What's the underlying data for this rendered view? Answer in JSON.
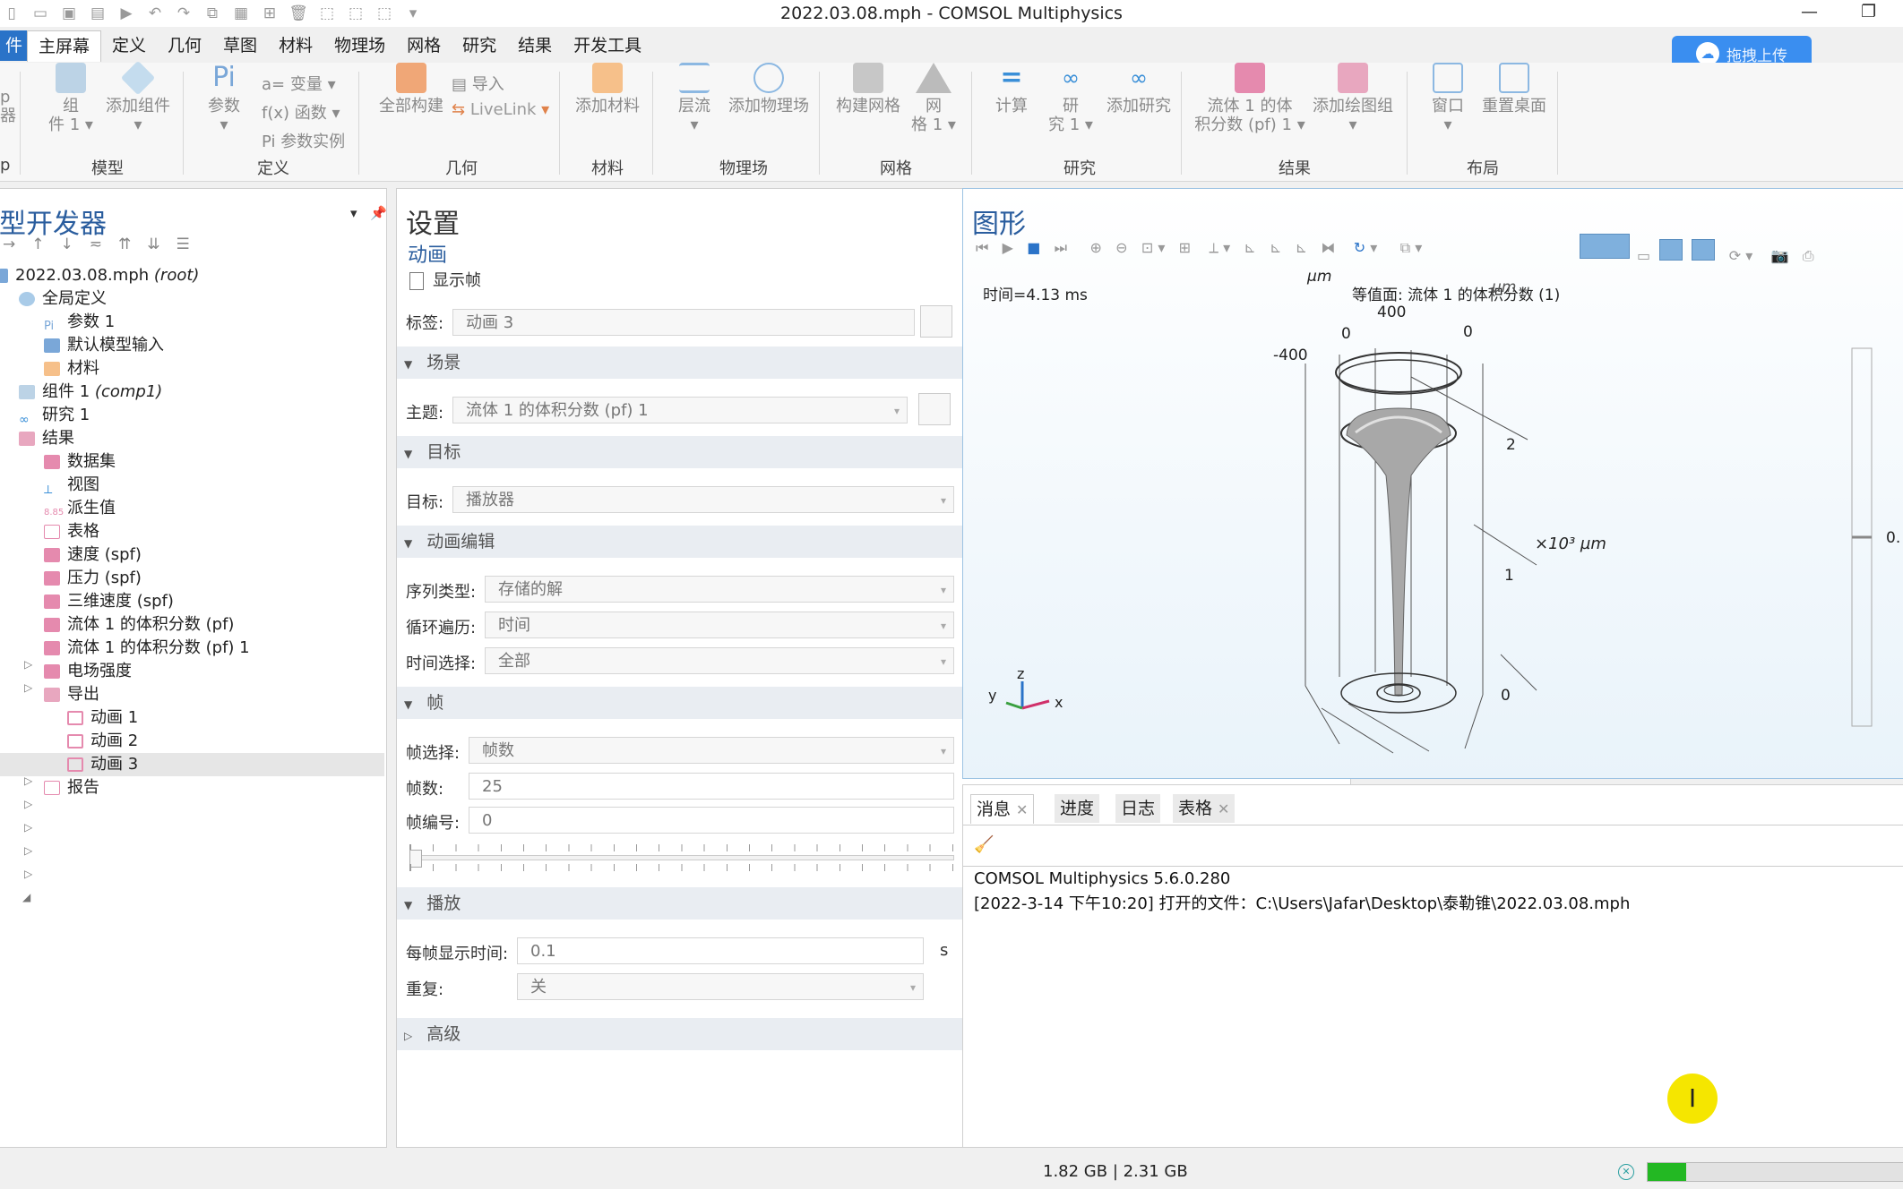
{
  "window": {
    "title": "2022.03.08.mph - COMSOL Multiphysics",
    "minimize": "—",
    "maximize": "❐"
  },
  "ribbon_tabs": [
    "件",
    "主屏幕",
    "定义",
    "几何",
    "草图",
    "材料",
    "物理场",
    "网格",
    "研究",
    "结果",
    "开发工具"
  ],
  "upload_button": "拖拽上传",
  "ribbon": {
    "groups": {
      "app": "p",
      "model": "模型",
      "define": "定义",
      "geometry": "几何",
      "materials": "材料",
      "physics": "物理场",
      "mesh": "网格",
      "study": "研究",
      "results": "结果",
      "layout": "布局"
    },
    "buttons": {
      "app_builder_1": "p",
      "app_builder_2": "器",
      "component_1": "组",
      "component_2": "件 1",
      "add_component": "添加组件",
      "parameters": "参数",
      "variables": "变量",
      "functions": "函数",
      "param_instances": "参数实例",
      "build_all": "全部构建",
      "import": "导入",
      "livelink": "LiveLink",
      "add_material": "添加材料",
      "laminar_flow": "层流",
      "add_physics": "添加物理场",
      "build_mesh": "构建网格",
      "mesh_1a": "网",
      "mesh_1b": "格 1",
      "compute": "计算",
      "study_1a": "研",
      "study_1b": "究 1",
      "add_study": "添加研究",
      "vol_frac_a": "流体 1 的体",
      "vol_frac_b": "积分数 (pf) 1",
      "add_plot_group": "添加绘图组",
      "windows": "窗口",
      "reset_desktop": "重置桌面"
    }
  },
  "model_builder": {
    "title": "型开发器",
    "tree": [
      {
        "label": "2022.03.08.mph",
        "tag": "(root)"
      },
      {
        "label": "全局定义"
      },
      {
        "label": "参数 1"
      },
      {
        "label": "默认模型输入"
      },
      {
        "label": "材料"
      },
      {
        "label": "组件 1",
        "tag": "(comp1)"
      },
      {
        "label": "研究 1"
      },
      {
        "label": "结果"
      },
      {
        "label": "数据集"
      },
      {
        "label": "视图"
      },
      {
        "label": "派生值"
      },
      {
        "label": "表格"
      },
      {
        "label": "速度 (spf)"
      },
      {
        "label": "压力 (spf)"
      },
      {
        "label": "三维速度 (spf)"
      },
      {
        "label": "流体 1 的体积分数 (pf)"
      },
      {
        "label": "流体 1 的体积分数 (pf) 1"
      },
      {
        "label": "电场强度"
      },
      {
        "label": "导出"
      },
      {
        "label": "动画 1"
      },
      {
        "label": "动画 2"
      },
      {
        "label": "动画 3"
      },
      {
        "label": "报告"
      }
    ]
  },
  "settings": {
    "title": "设置",
    "subtitle": "动画",
    "show_frame": "显示帧",
    "label_field": {
      "label": "标签:",
      "value": "动画 3"
    },
    "sections": {
      "scene": "场景",
      "target": "目标",
      "anim_edit": "动画编辑",
      "frames": "帧",
      "playback": "播放",
      "advanced": "高级"
    },
    "subject": {
      "label": "主题:",
      "value": "流体 1 的体积分数 (pf) 1"
    },
    "target_field": {
      "label": "目标:",
      "value": "播放器"
    },
    "sequence_type": {
      "label": "序列类型:",
      "value": "存储的解"
    },
    "loop_over": {
      "label": "循环遍历:",
      "value": "时间"
    },
    "time_select": {
      "label": "时间选择:",
      "value": "全部"
    },
    "frame_select": {
      "label": "帧选择:",
      "value": "帧数"
    },
    "frame_count": {
      "label": "帧数:",
      "value": "25"
    },
    "frame_number": {
      "label": "帧编号:",
      "value": "0"
    },
    "frame_time": {
      "label": "每帧显示时间:",
      "value": "0.1",
      "unit": "s"
    },
    "repeat": {
      "label": "重复:",
      "value": "关"
    }
  },
  "graphics": {
    "title": "图形",
    "time_label": "时间=4.13 ms",
    "plot_title": "等值面: 流体 1 的体积分数 (1)",
    "um_top": "µm",
    "um_overlap": "µm",
    "tick_m400": "-400",
    "tick_0a": "0",
    "tick_400": "400",
    "tick_0b": "0",
    "tick_2": "2",
    "tick_1": "1",
    "tick_0c": "0",
    "z_unit": "×10³ µm",
    "axis_x": "x",
    "axis_y": "y",
    "axis_z": "z",
    "colorbar_val": "0."
  },
  "messages": {
    "tabs": [
      "消息",
      "进度",
      "日志",
      "表格"
    ],
    "lines": [
      "COMSOL Multiphysics 5.6.0.280",
      "[2022-3-14 下午10:20] 打开的文件：C:\\Users\\Jafar\\Desktop\\泰勒锥\\2022.03.08.mph"
    ]
  },
  "status": {
    "memory": "1.82 GB | 2.31 GB",
    "progress": 0.15
  },
  "colors": {
    "accent": "#2a73c8",
    "panel_title": "#2a5d9e",
    "progress": "#23b823",
    "cursor_highlight": "#f5e600"
  }
}
